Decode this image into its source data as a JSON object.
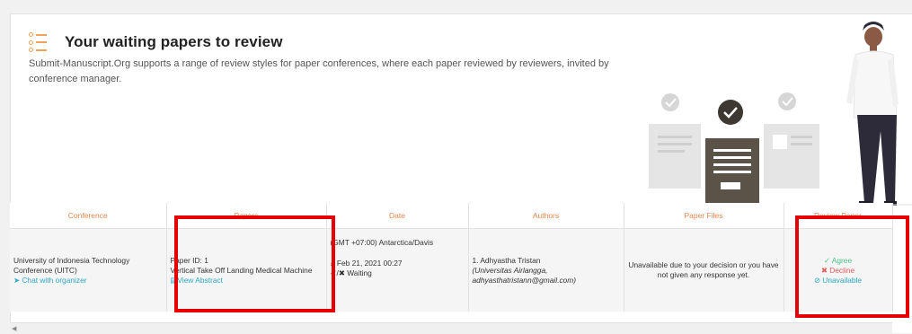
{
  "page": {
    "title": "Your waiting papers to review",
    "description": "Submit-Manuscript.Org supports a range of review styles for paper conferences, where each paper reviewed by reviewers, invited by conference manager."
  },
  "table": {
    "headers": [
      "Conference",
      "Papers",
      "Date",
      "Authors",
      "Paper Files",
      "Review Paper"
    ],
    "row": {
      "conference": "University of Indonesia Technology Conference (UITC)",
      "chat_link": "Chat with organizer",
      "paper_id": "Paper ID: 1",
      "paper_title": "Vertical Take Off Landing Medical Machine",
      "view_abstract": "View Abstract",
      "timezone": "(GMT +07:00) Antarctica/Davis",
      "date": "Feb 21, 2021 00:27",
      "status": "Waiting",
      "author_name": "1. Adhyastha Tristan",
      "author_affiliation": "(Universitas Airlangga, adhyasthatristann@gmail.com)",
      "paper_files": "Unavailable due to your decision or you have not given any response yet.",
      "agree": "Agree",
      "decline": "Decline",
      "unavailable": "Unavailable"
    }
  },
  "colors": {
    "accent_orange": "#e8864d",
    "link": "#2aa8c4",
    "agree": "#4cbf8a",
    "decline": "#e05c5c",
    "highlight": "#e60000"
  }
}
